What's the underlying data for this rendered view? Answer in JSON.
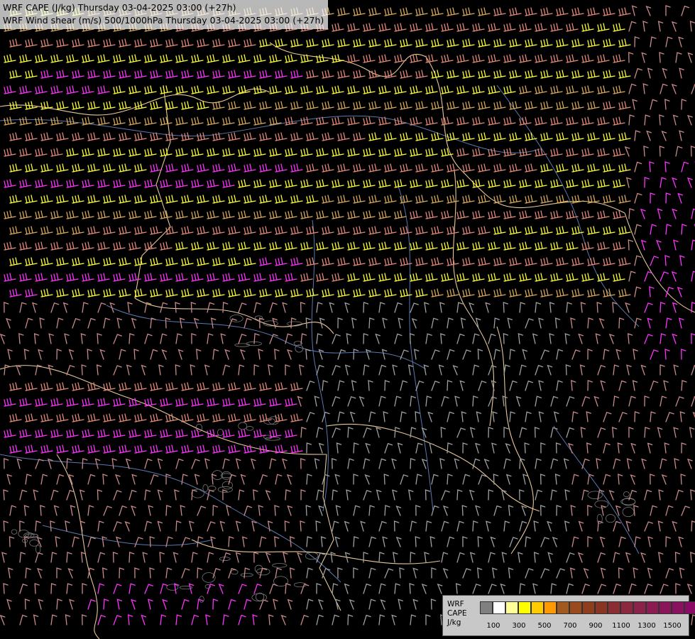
{
  "title": {
    "line1": "WRF CAPE (J/kg) Thursday 03-04-2025 03:00 (+27h)",
    "line2": "WRF Wind shear (m/s) 500/1000hPa Thursday 03-04-2025 03:00 (+27h)"
  },
  "legend": {
    "label_lines": [
      "WRF",
      "CAPE",
      "J/kg"
    ],
    "colors": [
      "#808080",
      "#ffffff",
      "#ffff99",
      "#ffff00",
      "#ffcc00",
      "#ff9900",
      "#a05a1e",
      "#9a4a1c",
      "#8f3e1d",
      "#8a3524",
      "#8a2e33",
      "#8a2840",
      "#8a224a",
      "#8a1c52",
      "#8a165a",
      "#8a1060",
      "#8a0a66"
    ],
    "tick_labels": [
      "100",
      "300",
      "500",
      "700",
      "900",
      "1100",
      "1300",
      "1500"
    ]
  },
  "map_colors": {
    "background": "#000000",
    "barb_yellow": "#ffff33",
    "barb_gold": "#d9a95a",
    "barb_salmon": "#e58a78",
    "barb_magenta": "#ff33ff",
    "barb_rose": "#c98a8a",
    "barb_grey": "#a0a0a0",
    "border": "#e8c79a",
    "river": "#5a78b0"
  }
}
